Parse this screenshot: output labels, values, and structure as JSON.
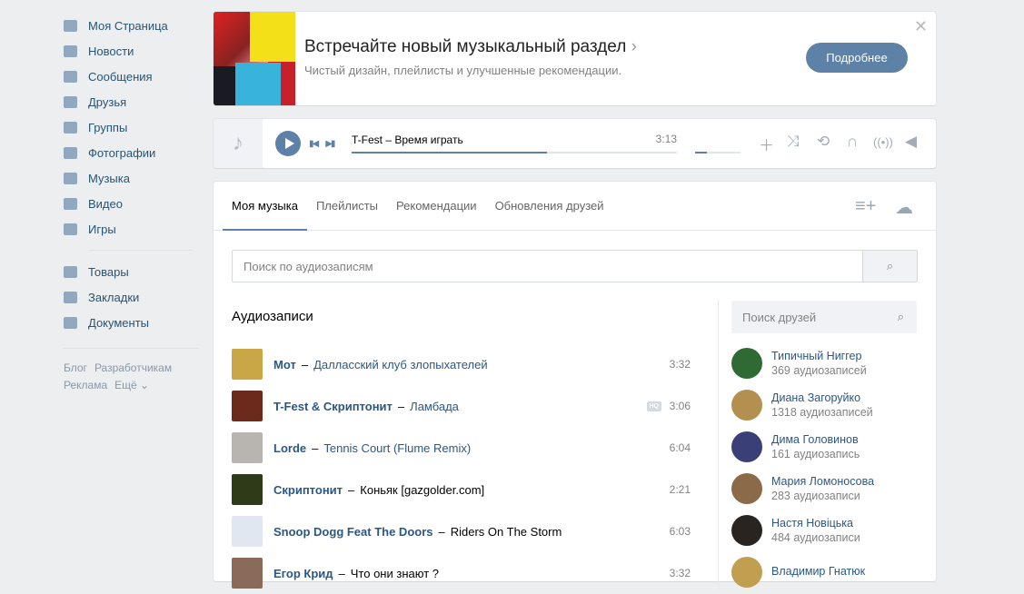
{
  "sidebar": {
    "items": [
      {
        "label": "Моя Страница",
        "icon": "home-icon"
      },
      {
        "label": "Новости",
        "icon": "news-icon"
      },
      {
        "label": "Сообщения",
        "icon": "messages-icon"
      },
      {
        "label": "Друзья",
        "icon": "friends-icon"
      },
      {
        "label": "Группы",
        "icon": "groups-icon"
      },
      {
        "label": "Фотографии",
        "icon": "camera-icon"
      },
      {
        "label": "Музыка",
        "icon": "music-icon"
      },
      {
        "label": "Видео",
        "icon": "video-icon"
      },
      {
        "label": "Игры",
        "icon": "gamepad-icon"
      }
    ],
    "items2": [
      {
        "label": "Товары",
        "icon": "bag-icon"
      },
      {
        "label": "Закладки",
        "icon": "star-icon"
      },
      {
        "label": "Документы",
        "icon": "document-icon"
      }
    ],
    "footer": [
      "Блог",
      "Разработчикам",
      "Реклама",
      "Ещё ⌄"
    ]
  },
  "banner": {
    "title": "Встречайте новый музыкальный раздел",
    "subtitle": "Чистый дизайн, плейлисты и улучшенные рекомендации.",
    "button": "Подробнее"
  },
  "player": {
    "artist": "T-Fest",
    "title": "Время играть",
    "time": "3:13",
    "progress": 0.6,
    "volume": 0.25
  },
  "tabs": [
    "Моя музыка",
    "Плейлисты",
    "Рекомендации",
    "Обновления друзей"
  ],
  "search": {
    "placeholder": "Поиск по аудиозаписям"
  },
  "heading": "Аудиозаписи",
  "tracks": [
    {
      "artist": "Мот",
      "title": "Далласский клуб злопыхателей",
      "duration": "3:32",
      "cover": "#c9a646"
    },
    {
      "artist": "T-Fest & Скриптонит",
      "title": "Ламбада",
      "duration": "3:06",
      "hq": "HQ",
      "cover": "#6b2a1c"
    },
    {
      "artist": "Lorde",
      "title": "Tennis Court (Flume Remix)",
      "duration": "6:04",
      "cover": "#b8b4b0"
    },
    {
      "artist": "Скриптонит",
      "title": "Коньяк [gazgolder.com]",
      "duration": "2:21",
      "cover": "#2e3a18"
    },
    {
      "artist": "Snoop Dogg Feat The Doors",
      "title": "Riders On The Storm",
      "duration": "6:03",
      "cover": "#e1e7f0"
    },
    {
      "artist": "Егор Крид",
      "title": "Что они знают ?",
      "duration": "3:32",
      "cover": "#8a6a58"
    }
  ],
  "friend_search": {
    "placeholder": "Поиск друзей"
  },
  "friends": [
    {
      "name": "Типичный Ниггер",
      "count": "369 аудиозаписей",
      "color": "#2f6a34"
    },
    {
      "name": "Диана Загоруйко",
      "count": "1318 аудиозаписей",
      "color": "#b39050"
    },
    {
      "name": "Дима Головинов",
      "count": "161 аудиозапись",
      "color": "#3a3f78"
    },
    {
      "name": "Мария Ломоносова",
      "count": "283 аудиозаписи",
      "color": "#8a6a48"
    },
    {
      "name": "Настя Новіцька",
      "count": "484 аудиозаписи",
      "color": "#2a2420"
    },
    {
      "name": "Владимир Гнатюк",
      "count": "",
      "color": "#c0a050"
    }
  ]
}
